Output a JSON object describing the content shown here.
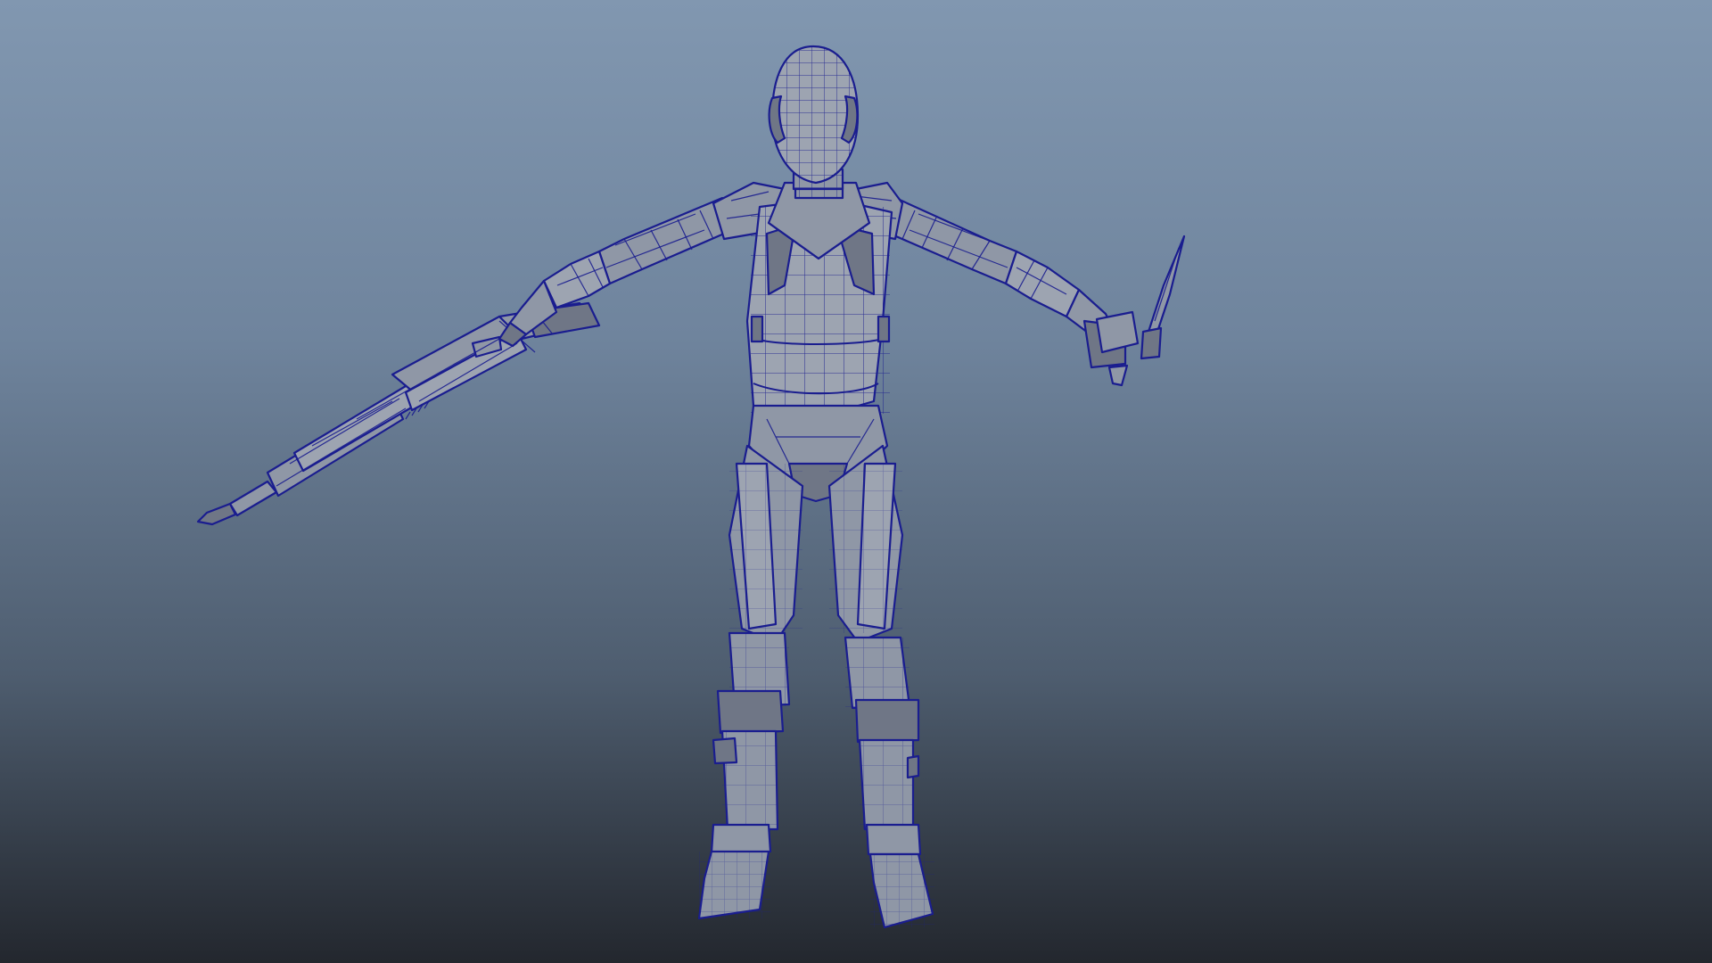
{
  "viewport": {
    "background_top": "#8197b0",
    "background_bottom": "#23272e",
    "wireframe_color": "#1a1d8f",
    "shaded_color": "#8f97a6"
  },
  "scene": {
    "model": "character-mesh",
    "pose": "t-pose",
    "props": [
      "rifle",
      "knife"
    ]
  }
}
